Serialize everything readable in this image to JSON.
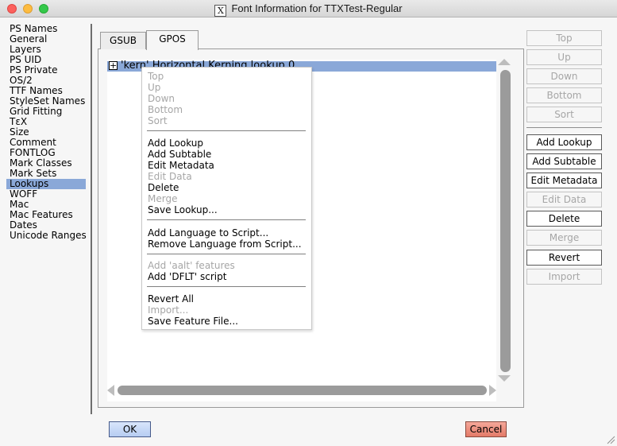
{
  "window": {
    "title": "Font Information for TTXTest-Regular"
  },
  "sidebar": {
    "selected": "Lookups",
    "items": [
      "PS Names",
      "General",
      "Layers",
      "PS UID",
      "PS Private",
      "OS/2",
      "TTF Names",
      "StyleSet Names",
      "Grid Fitting",
      "TεX",
      "Size",
      "Comment",
      "FONTLOG",
      "Mark Classes",
      "Mark Sets",
      "Lookups",
      "WOFF",
      "Mac",
      "Mac Features",
      "Dates",
      "Unicode Ranges"
    ]
  },
  "tabs": {
    "gsub": "GSUB",
    "gpos": "GPOS",
    "active": "GPOS"
  },
  "lookup_list": {
    "row_label": "'kern' Horizontal Kerning lookup 0"
  },
  "context_menu": {
    "top": "Top",
    "up": "Up",
    "down": "Down",
    "bottom": "Bottom",
    "sort": "Sort",
    "add_lookup": "Add Lookup",
    "add_subtable": "Add Subtable",
    "edit_metadata": "Edit Metadata",
    "edit_data": "Edit Data",
    "delete": "Delete",
    "merge": "Merge",
    "save_lookup": "Save Lookup...",
    "add_language": "Add Language to Script...",
    "remove_language": "Remove Language from Script...",
    "add_aalt": "Add 'aalt' features",
    "add_dflt": "Add 'DFLT' script",
    "revert_all": "Revert All",
    "import": "Import...",
    "save_feature_file": "Save Feature File..."
  },
  "right_buttons": {
    "top": "Top",
    "up": "Up",
    "down": "Down",
    "bottom": "Bottom",
    "sort": "Sort",
    "add_lookup": "Add Lookup",
    "add_subtable": "Add Subtable",
    "edit_metadata": "Edit Metadata",
    "edit_data": "Edit Data",
    "delete": "Delete",
    "merge": "Merge",
    "revert": "Revert",
    "import": "Import"
  },
  "footer": {
    "ok": "OK",
    "cancel": "Cancel"
  },
  "colors": {
    "selection": "#8aa8d8",
    "ok_button": "#b6cdf2",
    "cancel_button": "#e47a68"
  }
}
